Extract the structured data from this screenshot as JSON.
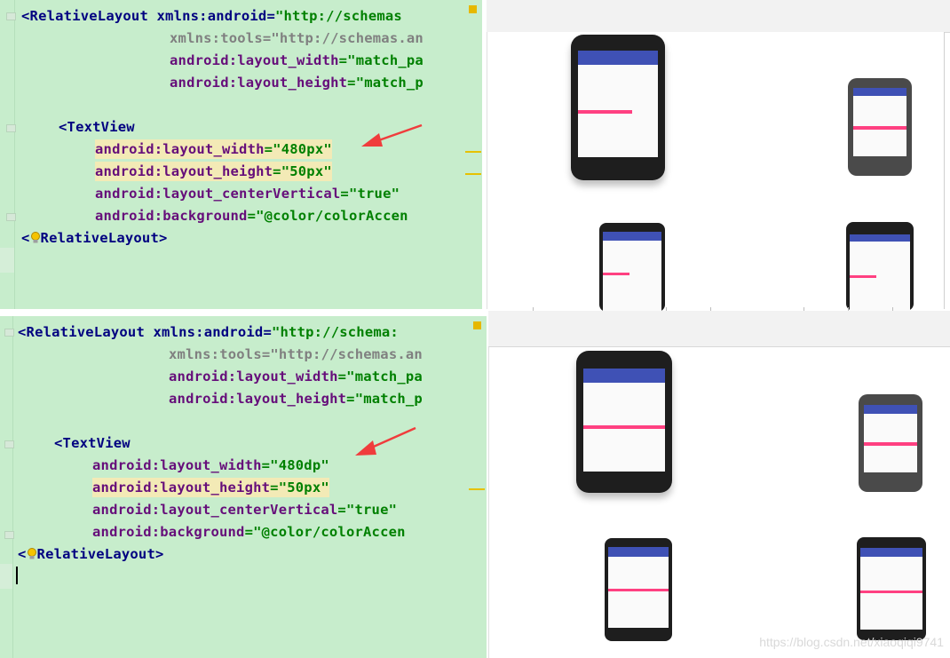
{
  "top": {
    "code": {
      "line1_tag": "<RelativeLayout",
      "line1_attr": " xmlns:android",
      "line1_eq": "=",
      "line1_val": "\"http://schemas",
      "line2": "xmlns:tools=\"http://schemas.an",
      "line3_attr": "android:layout_width",
      "line3_val": "=\"match_pa",
      "line4_attr": "android:layout_height",
      "line4_val": "=\"match_p",
      "line6_tag": "<TextView",
      "line7_attr": "android:layout_width",
      "line7_val": "=\"480px\"",
      "line8_attr": "android:layout_height",
      "line8_val": "=\"50px\"",
      "line9_attr": "android:layout_centerVertical",
      "line9_val": "=\"true\"",
      "line10_attr": "android:background",
      "line10_val": "=\"@color/colorAccen",
      "line11_a": "<",
      "line11_b": "RelativeLayout>"
    }
  },
  "bottom": {
    "code": {
      "line1_tag": "<RelativeLayout",
      "line1_attr": " xmlns:android",
      "line1_eq": "=",
      "line1_val": "\"http://schema:",
      "line2": "xmlns:tools=\"http://schemas.an",
      "line3_attr": "android:layout_width",
      "line3_val": "=\"match_pa",
      "line4_attr": "android:layout_height",
      "line4_val": "=\"match_p",
      "line6_tag": "<TextView",
      "line7_attr": "android:layout_width",
      "line7_val": "=\"480dp\"",
      "line8_attr": "android:layout_height",
      "line8_val": "=\"50px\"",
      "line9_attr": "android:layout_centerVertical",
      "line9_val": "=\"true\"",
      "line10_attr": "android:background",
      "line10_val": "=\"@color/colorAccen",
      "line11_a": "<",
      "line11_b": "RelativeLayout>"
    }
  },
  "colors": {
    "editor_bg": "#c7edcc",
    "app_bar": "#3f51b5",
    "accent": "#ff4081",
    "highlight": "#f3eab6"
  },
  "icons": [
    "red-arrow-icon",
    "lightbulb-icon",
    "fold-marker-icon",
    "warning-marker-icon"
  ],
  "watermark": "https://blog.csdn.net/xiaoqiqi9741"
}
